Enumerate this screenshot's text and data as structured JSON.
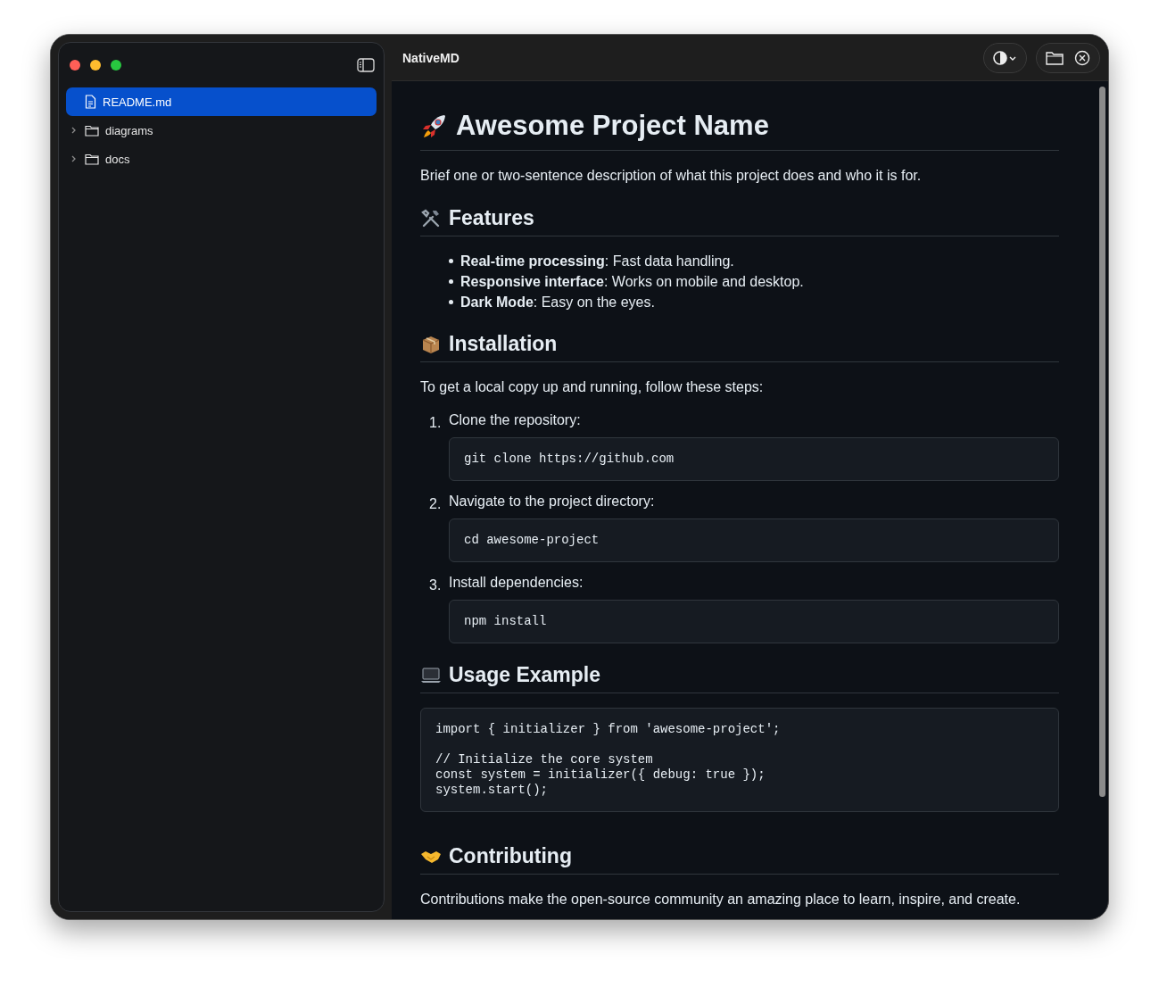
{
  "window": {
    "title": "NativeMD"
  },
  "sidebar": {
    "items": [
      {
        "kind": "file",
        "label": "README.md",
        "selected": true
      },
      {
        "kind": "folder",
        "label": "diagrams",
        "selected": false,
        "expanded": false
      },
      {
        "kind": "folder",
        "label": "docs",
        "selected": false,
        "expanded": false
      }
    ]
  },
  "document": {
    "blocks": [
      {
        "kind": "h1",
        "text": "Awesome Project Name"
      },
      {
        "kind": "p",
        "text": "Brief one or two-sentence description of what this project does and who it is for."
      },
      {
        "kind": "h2",
        "text": "Features"
      },
      {
        "kind": "ul",
        "items": [
          "**Real-time processing**: Fast data handling.",
          "**Responsive interface**: Works on mobile and desktop.",
          "**Dark Mode**: Easy on the eyes."
        ]
      },
      {
        "kind": "h2",
        "text": "Installation"
      },
      {
        "kind": "p",
        "text": "To get a local copy up and running, follow these steps:"
      },
      {
        "kind": "ol",
        "items": [
          {
            "number": "1.",
            "text": "Clone the repository:",
            "code": "git clone https://github.com"
          },
          {
            "number": "2.",
            "text": "Navigate to the project directory:",
            "code": "cd awesome-project"
          },
          {
            "number": "3.",
            "text": "Install dependencies:",
            "code": "npm install"
          }
        ]
      },
      {
        "kind": "h2",
        "text": "Usage Example"
      },
      {
        "kind": "code",
        "code": "import { initializer } from 'awesome-project';\n\n// Initialize the core system\nconst system = initializer({ debug: true });\nsystem.start();"
      },
      {
        "kind": "h2",
        "text": "Contributing"
      },
      {
        "kind": "p",
        "text": "Contributions make the open-source community an amazing place to learn, inspire, and create."
      }
    ]
  }
}
